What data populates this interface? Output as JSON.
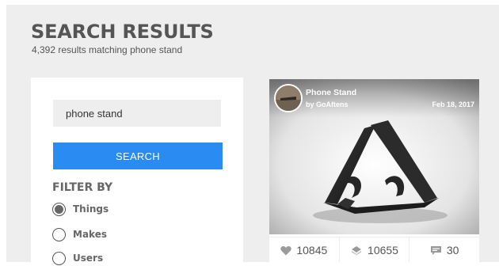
{
  "header": {
    "title": "SEARCH RESULTS",
    "subtitle": "4,392 results matching phone stand"
  },
  "sidebar": {
    "search_value": "phone stand",
    "search_button": "SEARCH",
    "filter_heading": "FILTER BY",
    "filters": [
      {
        "label": "Things",
        "checked": true
      },
      {
        "label": "Makes",
        "checked": false
      },
      {
        "label": "Users",
        "checked": false
      }
    ]
  },
  "result": {
    "title": "Phone Stand",
    "author": "by GoAftens",
    "date": "Feb 18, 2017",
    "likes": "10845",
    "collects": "10655",
    "comments": "30"
  },
  "colors": {
    "accent": "#2a8cf2",
    "page_background": "#eeeeee",
    "text": "#555555"
  },
  "icons": {
    "likes": "heart-icon",
    "collects": "collect-icon",
    "comments": "comment-icon"
  }
}
